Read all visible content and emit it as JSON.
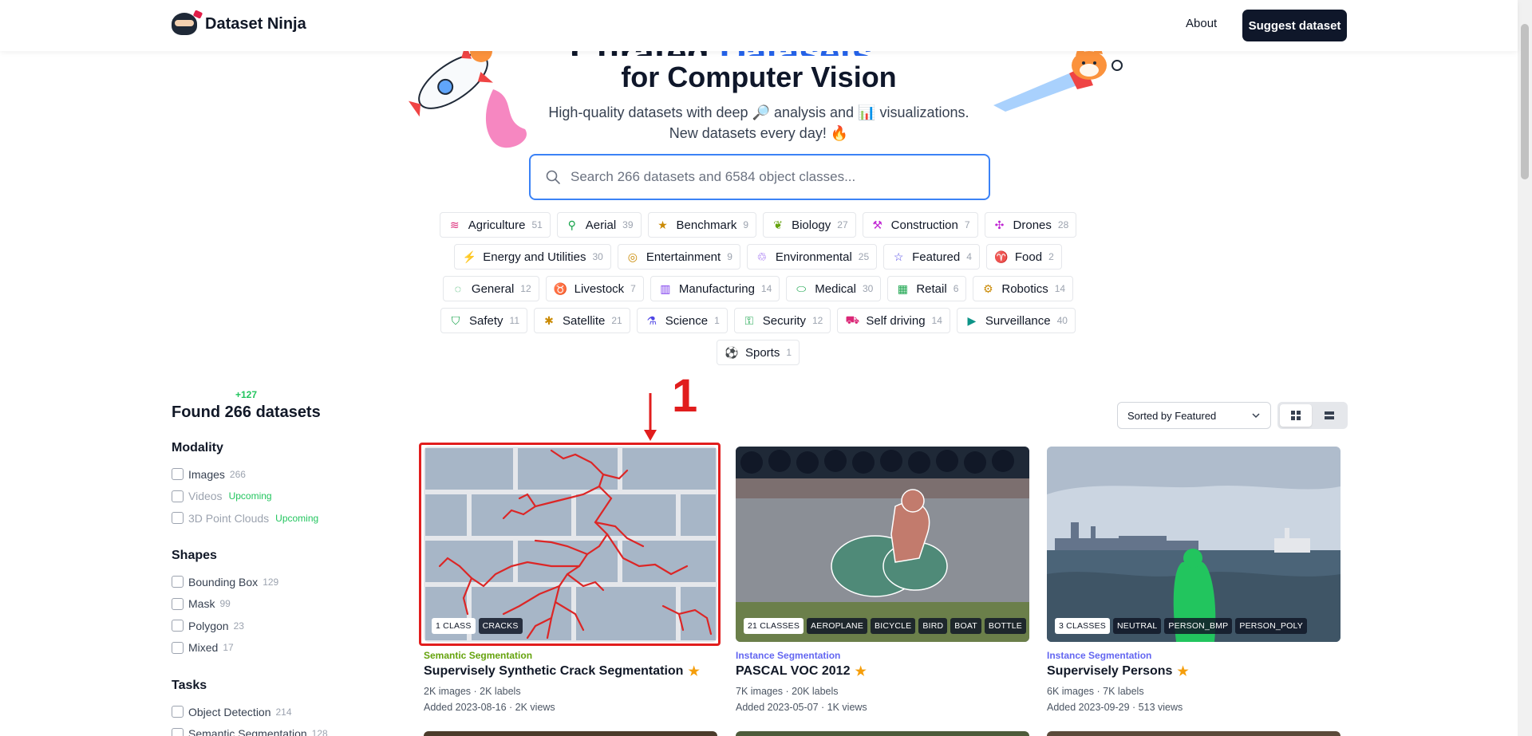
{
  "header": {
    "brand": "Dataset Ninja",
    "about": "About",
    "suggest": "Suggest dataset"
  },
  "hero": {
    "title_partial_a": "Curated ",
    "title_partial_b": "Datasets",
    "title": "for Computer Vision",
    "subtitle_line1_a": "High-quality datasets with deep ",
    "subtitle_line1_b": " analysis and ",
    "subtitle_line1_c": " visualizations.",
    "subtitle_line2": "New datasets every day! ",
    "icon_magnifier": "🔎",
    "icon_chart": "📊",
    "icon_fire": "🔥"
  },
  "search": {
    "placeholder": "Search 266 datasets and 6584 object classes..."
  },
  "tags": [
    [
      {
        "label": "Agriculture",
        "count": "51",
        "icon": "agriculture-icon",
        "glyph": "≋",
        "color": "#db2777"
      },
      {
        "label": "Aerial",
        "count": "39",
        "icon": "aerial-icon",
        "glyph": "⚲",
        "color": "#16a34a"
      },
      {
        "label": "Benchmark",
        "count": "9",
        "icon": "benchmark-icon",
        "glyph": "★",
        "color": "#ca8a04"
      },
      {
        "label": "Biology",
        "count": "27",
        "icon": "biology-icon",
        "glyph": "❦",
        "color": "#65a30d"
      },
      {
        "label": "Construction",
        "count": "7",
        "icon": "construction-icon",
        "glyph": "⚒",
        "color": "#c026d3"
      },
      {
        "label": "Drones",
        "count": "28",
        "icon": "drones-icon",
        "glyph": "✣",
        "color": "#c026d3"
      }
    ],
    [
      {
        "label": "Energy and Utilities",
        "count": "30",
        "icon": "energy-icon",
        "glyph": "⚡",
        "color": "#ca8a04"
      },
      {
        "label": "Entertainment",
        "count": "9",
        "icon": "entertainment-icon",
        "glyph": "◎",
        "color": "#ca8a04"
      },
      {
        "label": "Environmental",
        "count": "25",
        "icon": "environmental-icon",
        "glyph": "♲",
        "color": "#7c3aed"
      },
      {
        "label": "Featured",
        "count": "4",
        "icon": "featured-icon",
        "glyph": "☆",
        "color": "#4f46e5"
      },
      {
        "label": "Food",
        "count": "2",
        "icon": "food-icon",
        "glyph": "♈",
        "color": "#dc2626"
      }
    ],
    [
      {
        "label": "General",
        "count": "12",
        "icon": "general-icon",
        "glyph": "◌",
        "color": "#16a34a"
      },
      {
        "label": "Livestock",
        "count": "7",
        "icon": "livestock-icon",
        "glyph": "♉",
        "color": "#dc2626"
      },
      {
        "label": "Manufacturing",
        "count": "14",
        "icon": "manufacturing-icon",
        "glyph": "▥",
        "color": "#7c3aed"
      },
      {
        "label": "Medical",
        "count": "30",
        "icon": "medical-icon",
        "glyph": "⬭",
        "color": "#16a34a"
      },
      {
        "label": "Retail",
        "count": "6",
        "icon": "retail-icon",
        "glyph": "▦",
        "color": "#16a34a"
      },
      {
        "label": "Robotics",
        "count": "14",
        "icon": "robotics-icon",
        "glyph": "⚙",
        "color": "#ca8a04"
      }
    ],
    [
      {
        "label": "Safety",
        "count": "11",
        "icon": "safety-icon",
        "glyph": "⛉",
        "color": "#16a34a"
      },
      {
        "label": "Satellite",
        "count": "21",
        "icon": "satellite-icon",
        "glyph": "✱",
        "color": "#ca8a04"
      },
      {
        "label": "Science",
        "count": "1",
        "icon": "science-icon",
        "glyph": "⚗",
        "color": "#4f46e5"
      },
      {
        "label": "Security",
        "count": "12",
        "icon": "security-icon",
        "glyph": "⚿",
        "color": "#16a34a"
      },
      {
        "label": "Self driving",
        "count": "14",
        "icon": "self-driving-icon",
        "glyph": "⛟",
        "color": "#db2777"
      },
      {
        "label": "Surveillance",
        "count": "40",
        "icon": "surveillance-icon",
        "glyph": "▶",
        "color": "#0d9488"
      }
    ],
    [
      {
        "label": "Sports",
        "count": "1",
        "icon": "sports-icon",
        "glyph": "⚽",
        "color": "#0d9488"
      }
    ]
  ],
  "results": {
    "plus": "+127",
    "found": "Found 266 datasets"
  },
  "filters": {
    "modality": {
      "title": "Modality",
      "items": [
        {
          "label": "Images",
          "count": "266",
          "upcoming": ""
        },
        {
          "label": "Videos",
          "count": "",
          "upcoming": "Upcoming"
        },
        {
          "label": "3D Point Clouds",
          "count": "",
          "upcoming": "Upcoming"
        }
      ]
    },
    "shapes": {
      "title": "Shapes",
      "items": [
        {
          "label": "Bounding Box",
          "count": "129"
        },
        {
          "label": "Mask",
          "count": "99"
        },
        {
          "label": "Polygon",
          "count": "23"
        },
        {
          "label": "Mixed",
          "count": "17"
        }
      ]
    },
    "tasks": {
      "title": "Tasks",
      "items": [
        {
          "label": "Object Detection",
          "count": "214"
        },
        {
          "label": "Semantic Segmentation",
          "count": "128"
        }
      ]
    }
  },
  "sort": {
    "selected": "Sorted by Featured"
  },
  "cards": [
    {
      "task": "Semantic Segmentation",
      "task_color": "#65a30d",
      "title": "Supervisely Synthetic Crack Segmentation",
      "meta1": "2K images · 2K labels",
      "meta2": "Added 2023-08-16 · 2K views",
      "badges": [
        "1 CLASS",
        "CRACKS"
      ]
    },
    {
      "task": "Instance Segmentation",
      "task_color": "#6366f1",
      "title": "PASCAL VOC 2012",
      "meta1": "7K images · 20K labels",
      "meta2": "Added 2023-05-07 · 1K views",
      "badges": [
        "21 CLASSES",
        "AEROPLANE",
        "BICYCLE",
        "BIRD",
        "BOAT",
        "BOTTLE"
      ]
    },
    {
      "task": "Instance Segmentation",
      "task_color": "#6366f1",
      "title": "Supervisely Persons",
      "meta1": "6K images · 7K labels",
      "meta2": "Added 2023-09-29 · 513 views",
      "badges": [
        "3 CLASSES",
        "NEUTRAL",
        "PERSON_BMP",
        "PERSON_POLY"
      ]
    }
  ],
  "annotation": {
    "label": "1"
  },
  "colors": {
    "accent": "#2563eb",
    "annotation": "#e11d1d",
    "star": "#f59e0b",
    "upcoming": "#22c55e"
  }
}
